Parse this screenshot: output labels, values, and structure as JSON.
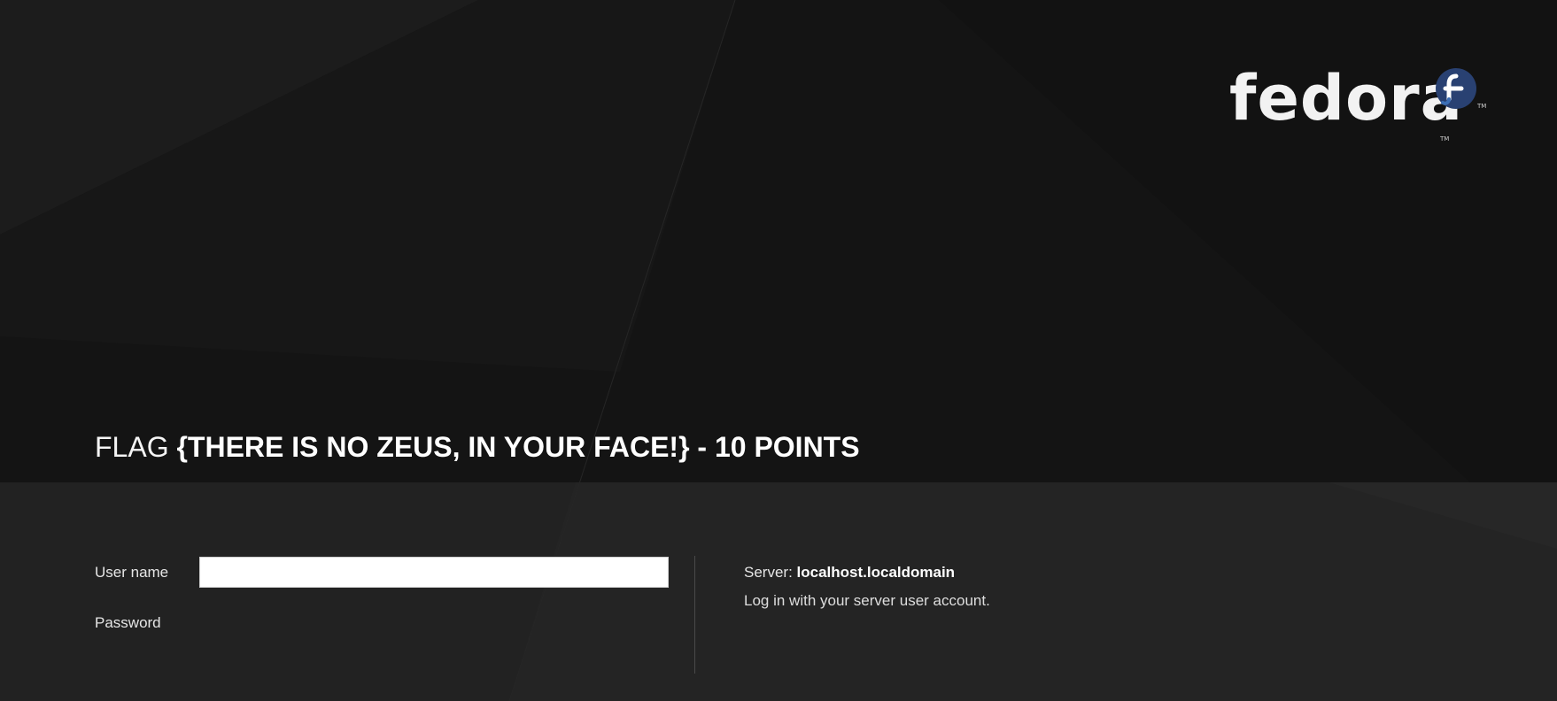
{
  "header": {
    "logo_text": "fedora",
    "logo_badge_letter": "f",
    "trademark": "TM",
    "accent_color": "#294172"
  },
  "title": {
    "prefix": "FLAG",
    "text": "{THERE IS NO ZEUS, IN YOUR FACE!} - 10 POINTS"
  },
  "login_form": {
    "username_label": "User name",
    "username_value": "",
    "password_label": "Password"
  },
  "server_info": {
    "label": "Server:",
    "value": "localhost.localdomain",
    "help_text": "Log in with your server user account."
  },
  "colors": {
    "background_top": "#151515",
    "background_bottom": "#222222",
    "text": "#ffffff"
  }
}
